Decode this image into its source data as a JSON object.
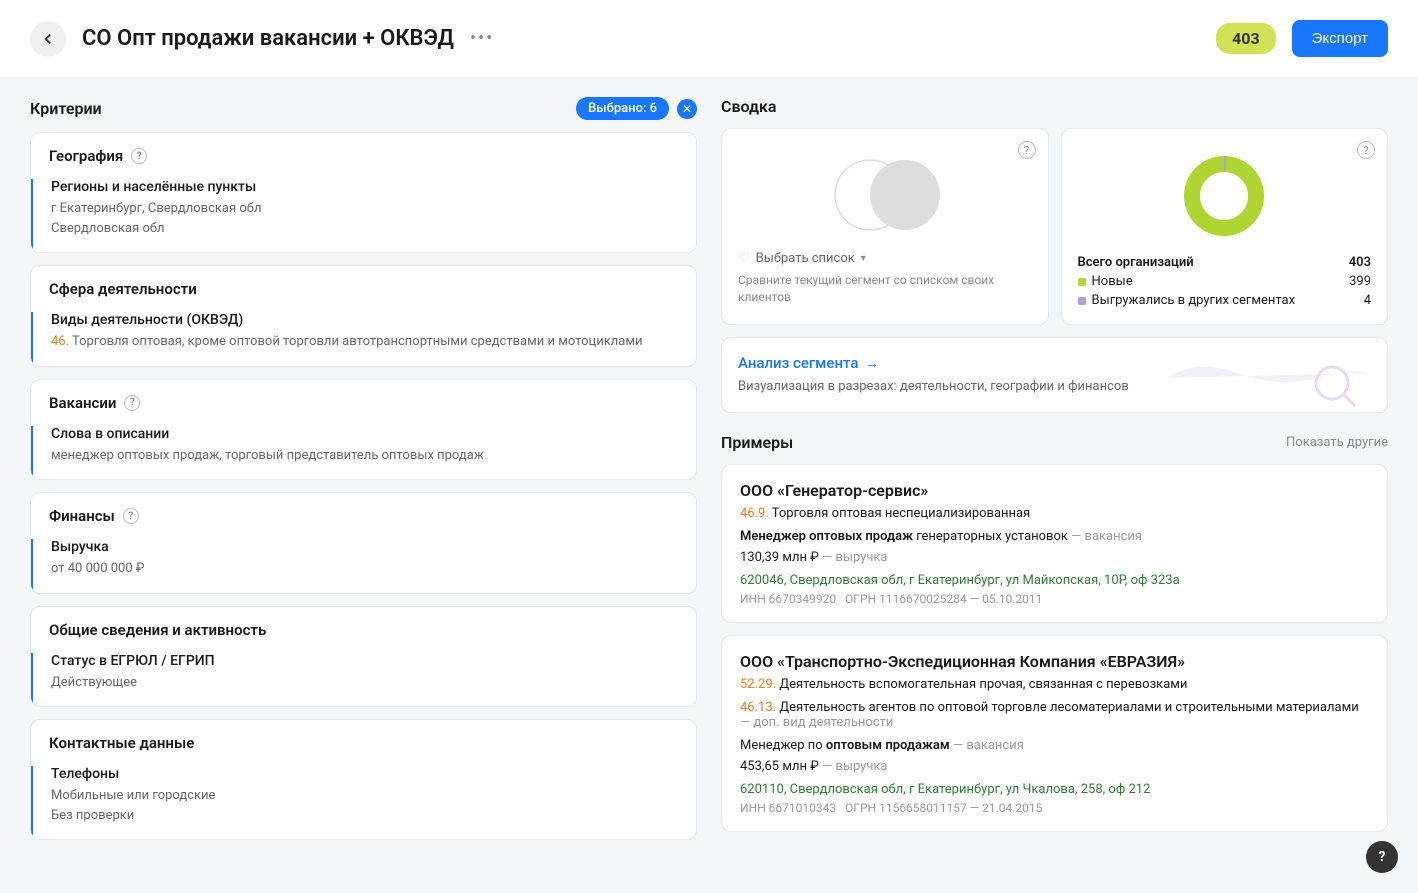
{
  "header": {
    "title": "СО Опт продажи вакансии + ОКВЭД",
    "count": "403",
    "export_label": "Экспорт"
  },
  "criteria": {
    "title": "Критерии",
    "selected_label": "Выбрано: 6",
    "cards": {
      "geography": {
        "title": "География",
        "field_label": "Регионы и населённые пункты",
        "value1": "г Екатеринбург, Свердловская обл",
        "value2": "Свердловская обл"
      },
      "activity": {
        "title": "Сфера деятельности",
        "field_label": "Виды деятельности (ОКВЭД)",
        "code": "46.",
        "desc": " Торговля оптовая, кроме оптовой торговли автотранспортными средствами и мотоциклами"
      },
      "vacancies": {
        "title": "Вакансии",
        "field_label": "Слова в описании",
        "value": "менеджер оптовых продаж, торговый представитель оптовых продаж"
      },
      "finance": {
        "title": "Финансы",
        "field_label": "Выручка",
        "value": "от 40 000 000 ₽"
      },
      "general": {
        "title": "Общие сведения и активность",
        "field_label": "Статус в ЕГРЮЛ / ЕГРИП",
        "value": "Действующее"
      },
      "contacts": {
        "title": "Контактные данные",
        "field_label": "Телефоны",
        "value1": "Мобильные или городские",
        "value2": "Без проверки"
      }
    }
  },
  "summary": {
    "title": "Сводка",
    "select_list": "Выбрать список",
    "compare_hint": "Сравните текущий сегмент со списком своих клиентов",
    "total_label": "Всего организаций",
    "total_value": "403",
    "new_label": "Новые",
    "new_value": "399",
    "exported_label": "Выгружались в других сегментах",
    "exported_value": "4"
  },
  "analysis": {
    "link": "Анализ сегмента",
    "desc": "Визуализация в разрезах: деятельности, географии и финансов"
  },
  "examples": {
    "title": "Примеры",
    "show_more": "Показать другие",
    "items": [
      {
        "name": "ООО «Генератор-сервис»",
        "okved_code": "46.9.",
        "okved_desc": " Торговля оптовая неспециализированная",
        "vacancy_bold": "Менеджер оптовых продаж",
        "vacancy_rest": " генераторных установок",
        "vacancy_tag": " — вакансия",
        "revenue": "130,39 млн ₽",
        "revenue_tag": " — выручка",
        "address": "620046, Свердловская обл, г Екатеринбург, ул Майкопская, 10Р, оф 323а",
        "inn": "ИНН 6670349920",
        "ogrn": "ОГРН 1116670025284",
        "date": "05.10.2011"
      },
      {
        "name": "ООО «Транспортно-Экспедиционная Компания «ЕВРАЗИЯ»",
        "okved_code": "52.29.",
        "okved_desc": " Деятельность вспомогательная прочая, связанная с перевозками",
        "okved2_code": "46.13.",
        "okved2_desc": " Деятельность агентов по оптовой торговле лесоматериалами и строительными материалами",
        "okved2_tag": " — доп. вид деятельности",
        "vacancy_pre": "Менеджер по ",
        "vacancy_bold": "оптовым продажам",
        "vacancy_tag": " — вакансия",
        "revenue": "453,65 млн ₽",
        "revenue_tag": " — выручка",
        "address": "620110, Свердловская обл, г Екатеринбург, ул Чкалова, 258, оф 212",
        "inn": "ИНН 6671010343",
        "ogrn": "ОГРН 1156658011157",
        "date": "21.04.2015"
      }
    ]
  },
  "chart_data": {
    "type": "pie",
    "title": "Всего организаций",
    "series": [
      {
        "name": "Новые",
        "value": 399,
        "color": "#aed531"
      },
      {
        "name": "Выгружались в других сегментах",
        "value": 4,
        "color": "#b39ddb"
      }
    ],
    "total": 403
  }
}
